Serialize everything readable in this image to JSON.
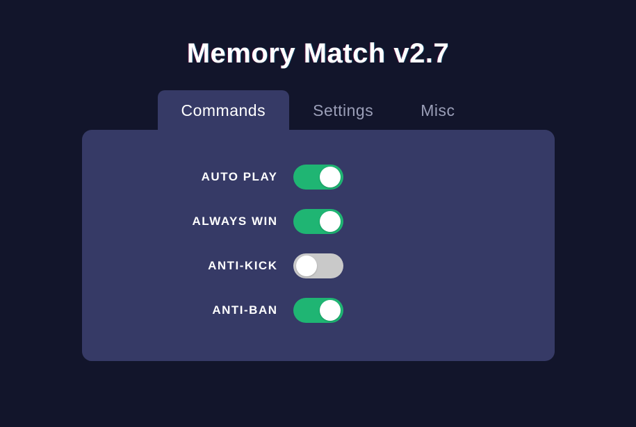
{
  "title": "Memory Match v2.7",
  "tabs": [
    {
      "label": "Commands",
      "active": true
    },
    {
      "label": "Settings",
      "active": false
    },
    {
      "label": "Misc",
      "active": false
    }
  ],
  "commands": [
    {
      "label": "AUTO PLAY",
      "on": true
    },
    {
      "label": "ALWAYS WIN",
      "on": true
    },
    {
      "label": "ANTI-KICK",
      "on": false
    },
    {
      "label": "ANTI-BAN",
      "on": true
    }
  ],
  "colors": {
    "background": "#12152b",
    "panel": "#363a66",
    "toggle_on": "#1fb573",
    "toggle_off": "#c9c9c9",
    "text": "#ffffff",
    "tab_inactive": "#9b9fb8"
  }
}
